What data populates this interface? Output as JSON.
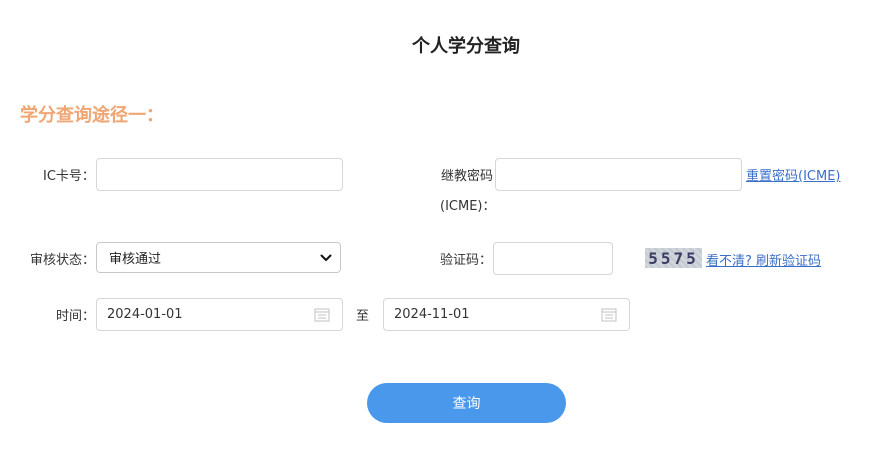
{
  "page": {
    "title": "个人学分查询"
  },
  "section": {
    "title": "学分查询途径一："
  },
  "form": {
    "ic_card": {
      "label": "IC卡号：",
      "value": ""
    },
    "password": {
      "label_line1": "继教密码",
      "label_line2": "(ICME)：",
      "value": "",
      "reset_link": "重置密码(ICME)"
    },
    "status": {
      "label": "审核状态：",
      "selected": "审核通过"
    },
    "captcha": {
      "label": "验证码：",
      "value": "",
      "image_text": "5575",
      "refresh_link": "看不清? 刷新验证码"
    },
    "time": {
      "label": "时间：",
      "start": "2024-01-01",
      "separator": "至",
      "end": "2024-11-01"
    },
    "submit_label": "查询"
  },
  "colors": {
    "section_title": "#f0a572",
    "link": "#3a6fc9",
    "button": "#4a98ec"
  },
  "icons": {
    "date": "calendar-icon",
    "select": "chevron-down-icon"
  }
}
